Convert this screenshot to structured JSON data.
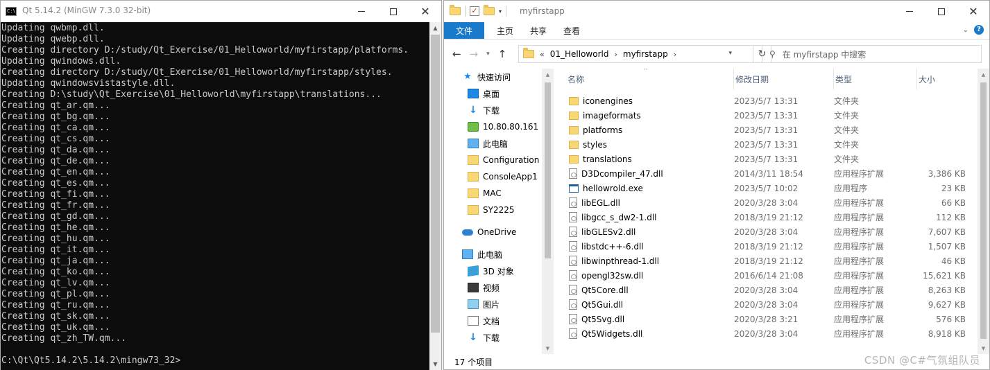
{
  "console": {
    "title": "Qt 5.14.2 (MinGW 7.3.0 32-bit)",
    "lines": [
      "Updating qwbmp.dll.",
      "Updating qwebp.dll.",
      "Creating directory D:/study/Qt_Exercise/01_Helloworld/myfirstapp/platforms.",
      "Updating qwindows.dll.",
      "Creating directory D:/study/Qt_Exercise/01_Helloworld/myfirstapp/styles.",
      "Updating qwindowsvistastyle.dll.",
      "Creating D:\\study\\Qt_Exercise\\01_Helloworld\\myfirstapp\\translations...",
      "Creating qt_ar.qm...",
      "Creating qt_bg.qm...",
      "Creating qt_ca.qm...",
      "Creating qt_cs.qm...",
      "Creating qt_da.qm...",
      "Creating qt_de.qm...",
      "Creating qt_en.qm...",
      "Creating qt_es.qm...",
      "Creating qt_fi.qm...",
      "Creating qt_fr.qm...",
      "Creating qt_gd.qm...",
      "Creating qt_he.qm...",
      "Creating qt_hu.qm...",
      "Creating qt_it.qm...",
      "Creating qt_ja.qm...",
      "Creating qt_ko.qm...",
      "Creating qt_lv.qm...",
      "Creating qt_pl.qm...",
      "Creating qt_ru.qm...",
      "Creating qt_sk.qm...",
      "Creating qt_uk.qm...",
      "Creating qt_zh_TW.qm...",
      "",
      "C:\\Qt\\Qt5.14.2\\5.14.2\\mingw73_32>"
    ]
  },
  "explorer": {
    "title": "myfirstapp",
    "ribbon_tabs": [
      "文件",
      "主页",
      "共享",
      "查看"
    ],
    "address": {
      "overflow": "«",
      "crumbs": [
        "01_Helloworld",
        "myfirstapp"
      ]
    },
    "search_placeholder": "在 myfirstapp 中搜索",
    "nav": [
      {
        "label": "快速访问",
        "icon": "star-icon",
        "pinned": false,
        "indent": 0
      },
      {
        "label": "桌面",
        "icon": "desktop-icon",
        "pinned": true,
        "indent": 1
      },
      {
        "label": "下载",
        "icon": "download-icon",
        "pinned": true,
        "indent": 1
      },
      {
        "label": "10.80.80.161",
        "icon": "network-drive-icon",
        "pinned": true,
        "indent": 1
      },
      {
        "label": "此电脑",
        "icon": "computer-icon",
        "pinned": true,
        "indent": 1
      },
      {
        "label": "Configuration",
        "icon": "folder-icon",
        "pinned": false,
        "indent": 1
      },
      {
        "label": "ConsoleApp1",
        "icon": "folder-icon",
        "pinned": false,
        "indent": 1
      },
      {
        "label": "MAC",
        "icon": "folder-icon",
        "pinned": false,
        "indent": 1
      },
      {
        "label": "SY2225",
        "icon": "folder-icon",
        "pinned": false,
        "indent": 1
      },
      {
        "label": "",
        "icon": "",
        "pinned": false,
        "indent": 0
      },
      {
        "label": "OneDrive",
        "icon": "cloud-icon",
        "pinned": false,
        "indent": 0
      },
      {
        "label": "",
        "icon": "",
        "pinned": false,
        "indent": 0
      },
      {
        "label": "此电脑",
        "icon": "computer-icon",
        "pinned": false,
        "indent": 0
      },
      {
        "label": "3D 对象",
        "icon": "3d-objects-icon",
        "pinned": false,
        "indent": 1
      },
      {
        "label": "视频",
        "icon": "video-icon",
        "pinned": false,
        "indent": 1
      },
      {
        "label": "图片",
        "icon": "pictures-icon",
        "pinned": false,
        "indent": 1
      },
      {
        "label": "文档",
        "icon": "documents-icon",
        "pinned": false,
        "indent": 1
      },
      {
        "label": "下载",
        "icon": "download-icon",
        "pinned": false,
        "indent": 1
      }
    ],
    "columns": [
      "名称",
      "修改日期",
      "类型",
      "大小"
    ],
    "files": [
      {
        "name": "iconengines",
        "date": "2023/5/7 13:31",
        "type": "文件夹",
        "size": "",
        "kind": "folder"
      },
      {
        "name": "imageformats",
        "date": "2023/5/7 13:31",
        "type": "文件夹",
        "size": "",
        "kind": "folder"
      },
      {
        "name": "platforms",
        "date": "2023/5/7 13:31",
        "type": "文件夹",
        "size": "",
        "kind": "folder"
      },
      {
        "name": "styles",
        "date": "2023/5/7 13:31",
        "type": "文件夹",
        "size": "",
        "kind": "folder"
      },
      {
        "name": "translations",
        "date": "2023/5/7 13:31",
        "type": "文件夹",
        "size": "",
        "kind": "folder"
      },
      {
        "name": "D3Dcompiler_47.dll",
        "date": "2014/3/11 18:54",
        "type": "应用程序扩展",
        "size": "3,386 KB",
        "kind": "dll"
      },
      {
        "name": "hellowrold.exe",
        "date": "2023/5/7 10:02",
        "type": "应用程序",
        "size": "23 KB",
        "kind": "exe"
      },
      {
        "name": "libEGL.dll",
        "date": "2020/3/28 3:04",
        "type": "应用程序扩展",
        "size": "66 KB",
        "kind": "dll"
      },
      {
        "name": "libgcc_s_dw2-1.dll",
        "date": "2018/3/19 21:12",
        "type": "应用程序扩展",
        "size": "112 KB",
        "kind": "dll"
      },
      {
        "name": "libGLESv2.dll",
        "date": "2020/3/28 3:04",
        "type": "应用程序扩展",
        "size": "7,607 KB",
        "kind": "dll"
      },
      {
        "name": "libstdc++-6.dll",
        "date": "2018/3/19 21:12",
        "type": "应用程序扩展",
        "size": "1,507 KB",
        "kind": "dll"
      },
      {
        "name": "libwinpthread-1.dll",
        "date": "2018/3/19 21:12",
        "type": "应用程序扩展",
        "size": "46 KB",
        "kind": "dll"
      },
      {
        "name": "opengl32sw.dll",
        "date": "2016/6/14 21:08",
        "type": "应用程序扩展",
        "size": "15,621 KB",
        "kind": "dll"
      },
      {
        "name": "Qt5Core.dll",
        "date": "2020/3/28 3:04",
        "type": "应用程序扩展",
        "size": "8,263 KB",
        "kind": "dll"
      },
      {
        "name": "Qt5Gui.dll",
        "date": "2020/3/28 3:04",
        "type": "应用程序扩展",
        "size": "9,627 KB",
        "kind": "dll"
      },
      {
        "name": "Qt5Svg.dll",
        "date": "2020/3/28 3:21",
        "type": "应用程序扩展",
        "size": "576 KB",
        "kind": "dll"
      },
      {
        "name": "Qt5Widgets.dll",
        "date": "2020/3/28 3:04",
        "type": "应用程序扩展",
        "size": "8,918 KB",
        "kind": "dll"
      }
    ],
    "status": "17 个项目"
  },
  "watermark": "CSDN @C#气氛组队员"
}
